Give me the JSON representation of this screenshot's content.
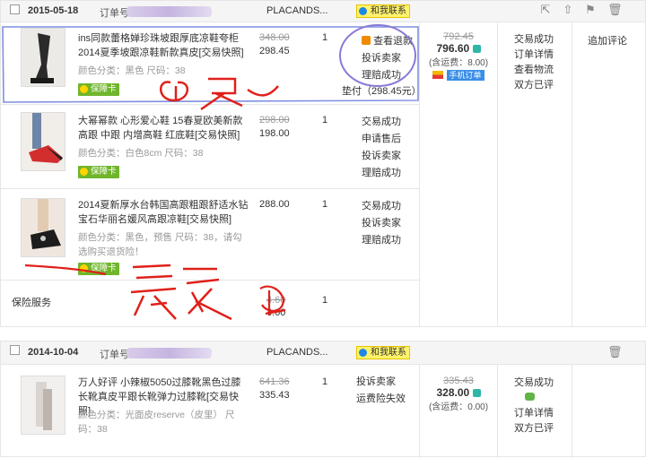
{
  "order1": {
    "date": "2015-05-18",
    "order_no_label": "订单号:",
    "shop": "PLACANDS...",
    "chat_label": "和我联系",
    "items": [
      {
        "title": "ins同款蕾格婵珍珠坡跟厚底凉鞋夸柜2014夏季坡跟凉鞋新款真皮[交易快照]",
        "attr": "颜色分类：黑色  尺码：38",
        "badge": "保障卡",
        "orig_price": "348.00",
        "price": "298.45",
        "qty": "1",
        "ops": [
          "查看退款",
          "投诉卖家",
          "理赔成功"
        ],
        "advance": "垫付（298.45元）"
      },
      {
        "title": "大幂幂款 心形爱心鞋 15春夏欧美新款 高跟 中跟 内增高鞋 红底鞋[交易快照]",
        "attr": "颜色分类：白色8cm  尺码：38",
        "badge": "保障卡",
        "orig_price": "298.00",
        "price": "198.00",
        "qty": "1",
        "ops": [
          "交易成功",
          "申请售后",
          "投诉卖家",
          "理赔成功"
        ]
      },
      {
        "title": "2014夏新厚水台韩国高跟粗跟舒适水钻宝石华丽名媛风高跟凉鞋[交易快照]",
        "attr": "颜色分类：黑色，预售  尺码：38，请勾选购买退货险！",
        "badge": "保障卡",
        "price": "288.00",
        "qty": "1",
        "ops": [
          "交易成功",
          "投诉卖家",
          "理赔成功"
        ]
      }
    ],
    "insurance": {
      "label": "保险服务",
      "orig_price": "4.60",
      "price": "4.60",
      "qty": "1"
    },
    "total": {
      "orig": "792.45",
      "paid": "796.60",
      "shipping": "(含运费：8.00)",
      "mobile_label": "手机订单"
    },
    "status": [
      "交易成功",
      "订单详情",
      "查看物流",
      "双方已评"
    ],
    "action": "追加评论",
    "annotation_1": "已退",
    "annotation_2": "最爱"
  },
  "order2": {
    "date": "2014-10-04",
    "order_no_label": "订单号:",
    "shop": "PLACANDS...",
    "chat_label": "和我联系",
    "item": {
      "title": "万人好评 小辣椒5050过膝靴黑色过膝长靴真皮平跟长靴弹力过膝靴[交易快照]",
      "attr": "颜色分类：光面皮reserve（皮里）  尺码：38",
      "orig_price": "641.36",
      "price": "335.43",
      "qty": "1",
      "ops": [
        "投诉卖家",
        "运费险失效"
      ]
    },
    "total": {
      "orig": "335.43",
      "paid": "328.00",
      "shipping": "(含运费：0.00)"
    },
    "status": [
      "交易成功",
      "订单详情",
      "双方已评"
    ]
  },
  "colors": {
    "annotation_red": "#e0201a",
    "circle_purple": "#8a7ad6"
  }
}
